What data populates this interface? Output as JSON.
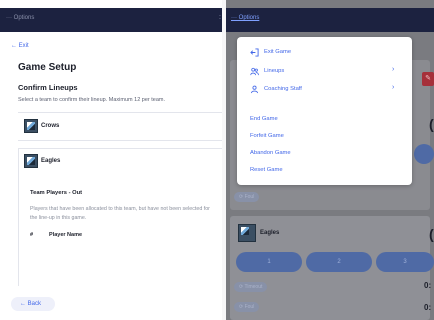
{
  "left": {
    "topbar_title": "··· Options",
    "exit_label": "← Exit",
    "page_title": "Game Setup",
    "section_title": "Confirm Lineups",
    "section_subtitle": "Select a team to confirm their lineup. Maximum 12 per team.",
    "teams": [
      {
        "name": "Crows"
      },
      {
        "name": "Eagles"
      }
    ],
    "team_players_out_title": "Team Players - Out",
    "team_players_out_desc": "Players that have been allocated to this team, but have not been selected for the line-up in this game.",
    "columns": {
      "number": "#",
      "player_name": "Player Name"
    },
    "back_label": "← Back"
  },
  "right": {
    "topbar_title": "··· Options",
    "menu": {
      "items_top": [
        {
          "icon": "exit-icon",
          "label": "Exit Game",
          "has_chevron": false
        },
        {
          "icon": "people-icon",
          "label": "Lineups",
          "has_chevron": true
        },
        {
          "icon": "person-icon",
          "label": "Coaching Staff",
          "has_chevron": true
        }
      ],
      "items_bottom": [
        {
          "label": "End Game"
        },
        {
          "label": "Forfeit Game"
        },
        {
          "label": "Abandon Game"
        },
        {
          "label": "Reset Game"
        }
      ],
      "chevron": "›"
    },
    "foul_label": "⟳ Foul",
    "timeout_label": "⟳ Timeout",
    "team_name": "Eagles",
    "period_buttons": [
      "1",
      "2",
      "3"
    ],
    "score_digit_1": "(",
    "score_digit_2": "(",
    "score_digit_3": "0:",
    "score_digit_4": "0:",
    "edit_icon": "pencil-icon",
    "colors": {
      "accent": "#4267e8",
      "topbar": "#1c2240",
      "overlay": "#7a7b80"
    }
  }
}
